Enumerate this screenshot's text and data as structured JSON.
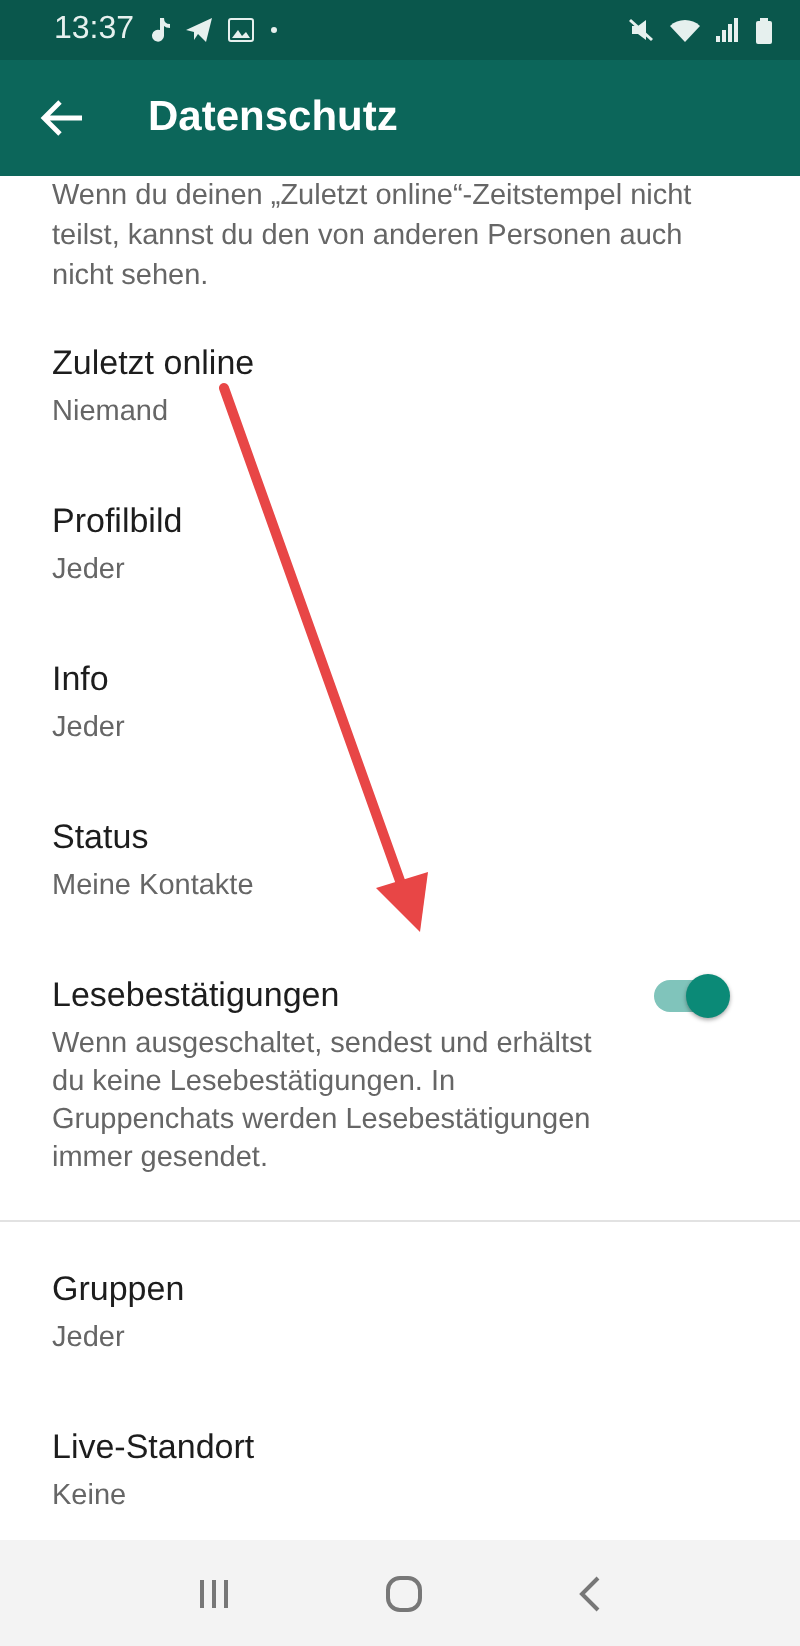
{
  "status_bar": {
    "time": "13:37"
  },
  "app_bar": {
    "title": "Datenschutz"
  },
  "sections": [
    {
      "intro": "Wenn du deinen „Zuletzt online“-Zeitstempel nicht teilst, kannst du den von anderen Personen auch nicht sehen.",
      "items": [
        {
          "kind": "choice",
          "title": "Zuletzt online",
          "value": "Niemand"
        },
        {
          "kind": "choice",
          "title": "Profilbild",
          "value": "Jeder"
        },
        {
          "kind": "choice",
          "title": "Info",
          "value": "Jeder"
        },
        {
          "kind": "choice",
          "title": "Status",
          "value": "Meine Kontakte"
        },
        {
          "kind": "toggle",
          "title": "Lesebestätigungen",
          "description": "Wenn ausgeschaltet, sendest und erhältst du keine Lesebestätigungen. In Gruppenchats werden Lesebestätigungen immer gesendet.",
          "on": true
        }
      ]
    },
    {
      "items": [
        {
          "kind": "choice",
          "title": "Gruppen",
          "value": "Jeder"
        },
        {
          "kind": "choice",
          "title": "Live-Standort",
          "value": "Keine"
        }
      ]
    }
  ]
}
